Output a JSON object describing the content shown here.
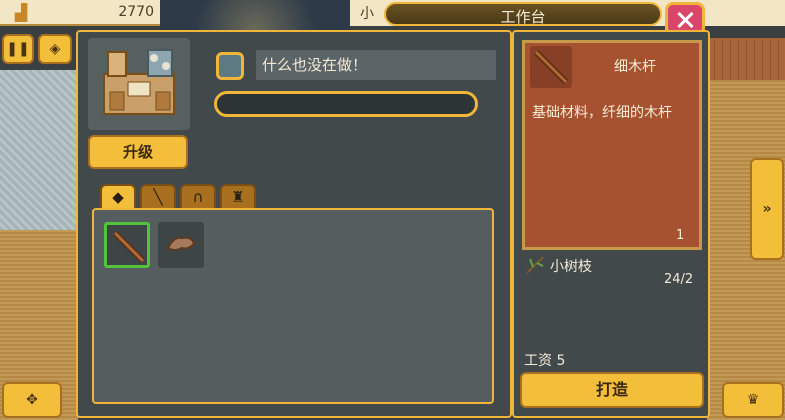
{
  "hud": {
    "money": "2770",
    "partial_label": "小"
  },
  "window": {
    "title": "工作台"
  },
  "station": {
    "upgrade_label": "升级",
    "status_text": "什么也没在做！",
    "progress": 0
  },
  "tabs": [
    {
      "icon": "tool-tab-icon",
      "active": true
    },
    {
      "icon": "weapon-tab-icon",
      "active": false
    },
    {
      "icon": "helmet-tab-icon",
      "active": false
    },
    {
      "icon": "armor-tab-icon",
      "active": false
    }
  ],
  "items": [
    {
      "icon": "thin-stick-icon",
      "selected": true
    },
    {
      "icon": "leather-icon",
      "selected": false
    }
  ],
  "detail": {
    "name": "细木杆",
    "description": "基础材料，纤细的木杆",
    "count": "1",
    "ingredient_name": "小树枝",
    "ingredient_count": "24/2",
    "wage_label": "工资 5",
    "craft_label": "打造"
  },
  "colors": {
    "accent": "#f0b63a",
    "panel": "#41494b",
    "card": "#a6512f",
    "selected": "#52c33a",
    "close": "#d9466a"
  }
}
